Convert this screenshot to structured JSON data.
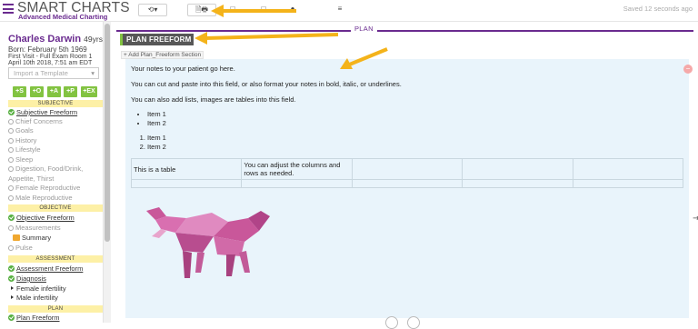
{
  "app": {
    "title": "SMART CHARTS",
    "subtitle": "Advanced Medical Charting",
    "saved_status": "Saved 12 seconds ago",
    "toolbar": {
      "history_btn": "⟲▾",
      "print_btn": "🗎🖶"
    },
    "accent": "#6a2b8f",
    "green": "#82c341"
  },
  "patient": {
    "name": "Charles Darwin",
    "age": "49yrs.",
    "born": "Born: February 5th 1969",
    "visit": "First Visit - Full Exam Room 1",
    "datetime": "April 10th 2018, 7:51 am EDT"
  },
  "sidebar": {
    "template_placeholder": "Import a Template",
    "quick_buttons": [
      "+S",
      "+O",
      "+A",
      "+P",
      "+EX"
    ],
    "subjective": {
      "header": "SUBJECTIVE",
      "items": [
        {
          "label": "Subjective Freeform",
          "state": "done"
        },
        {
          "label": "Chief Concerns",
          "state": "todo"
        },
        {
          "label": "Goals",
          "state": "todo"
        },
        {
          "label": "History",
          "state": "todo"
        },
        {
          "label": "Lifestyle",
          "state": "todo"
        },
        {
          "label": "Sleep",
          "state": "todo"
        },
        {
          "label": "Digestion, Food/Drink,",
          "state": "todo"
        },
        {
          "label": "Appetite, Thirst",
          "state": "none"
        },
        {
          "label": "Female Reproductive",
          "state": "todo"
        },
        {
          "label": "Male Reproductive",
          "state": "todo"
        }
      ]
    },
    "objective": {
      "header": "OBJECTIVE",
      "items": [
        {
          "label": "Objective Freeform",
          "state": "done"
        },
        {
          "label": "Measurements",
          "state": "todo"
        },
        {
          "label": "Summary",
          "state": "sub"
        },
        {
          "label": "Pulse",
          "state": "todo"
        }
      ]
    },
    "assessment": {
      "header": "ASSESSMENT",
      "items": [
        {
          "label": "Assessment Freeform",
          "state": "done"
        },
        {
          "label": "Diagnosis",
          "state": "done"
        },
        {
          "label": "Female infertility",
          "state": "child"
        },
        {
          "label": "Male infertility",
          "state": "child"
        }
      ]
    },
    "plan": {
      "header": "PLAN",
      "items": [
        {
          "label": "Plan Freeform",
          "state": "done"
        }
      ]
    }
  },
  "main": {
    "section_label": "PLAN",
    "block_title": "PLAN FREEFORM",
    "add_link": "+ Add Plan_Freeform Section",
    "editor": {
      "line1": "Your notes to your patient go here.",
      "line2": "You can cut and paste into this field, or also format your notes in bold, italic, or underlines.",
      "line3": "You can also add lists, images are tables into this field.",
      "bullets": [
        "Item 1",
        "Item 2"
      ],
      "numbered": [
        "Item 1",
        "Item 2"
      ],
      "table": [
        [
          "This is a table",
          "You can adjust the columns and rows as needed.",
          "",
          "",
          ""
        ],
        [
          "",
          "",
          "",
          "",
          ""
        ]
      ],
      "image_icon": "origami-bull-image"
    }
  }
}
